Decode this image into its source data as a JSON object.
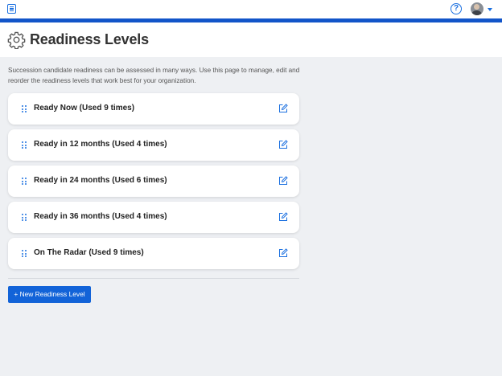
{
  "topbar": {
    "menu_icon": "list-icon",
    "help_label": "?",
    "accent_color": "#1255c9"
  },
  "header": {
    "title": "Readiness Levels",
    "icon": "gear-icon"
  },
  "description": "Succession candidate readiness can be assessed in many ways. Use this page to manage, edit and reorder the readiness levels that work best for your organization.",
  "levels": [
    {
      "label": "Ready Now (Used 9 times)"
    },
    {
      "label": "Ready in 12 months (Used 4 times)"
    },
    {
      "label": "Ready in 24 months (Used 6 times)"
    },
    {
      "label": "Ready in 36 months (Used 4 times)"
    },
    {
      "label": "On The Radar (Used 9 times)"
    }
  ],
  "new_button_label": "+ New Readiness Level",
  "colors": {
    "primary": "#1263d8",
    "background": "#eef0f3"
  }
}
